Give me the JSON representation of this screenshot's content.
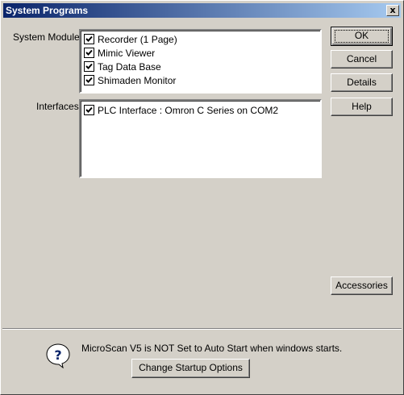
{
  "window": {
    "title": "System Programs",
    "close_glyph": "x"
  },
  "modules": {
    "label": "System Modules",
    "items": [
      {
        "label": "Recorder (1 Page)",
        "checked": true
      },
      {
        "label": "Mimic Viewer",
        "checked": true
      },
      {
        "label": "Tag Data Base",
        "checked": true
      },
      {
        "label": "Shimaden Monitor",
        "checked": true
      }
    ]
  },
  "interfaces": {
    "label": "Interfaces",
    "items": [
      {
        "label": "PLC Interface : Omron C Series on COM2",
        "checked": true
      }
    ]
  },
  "buttons": {
    "ok": "OK",
    "cancel": "Cancel",
    "details": "Details",
    "help": "Help",
    "accessories": "Accessories",
    "change_startup": "Change Startup Options"
  },
  "footer": {
    "message": "MicroScan V5 is NOT Set to Auto Start when windows starts.",
    "icon": "question-icon"
  },
  "colors": {
    "title_start": "#0a246a",
    "title_end": "#a6caf0",
    "face": "#d4d0c8"
  }
}
